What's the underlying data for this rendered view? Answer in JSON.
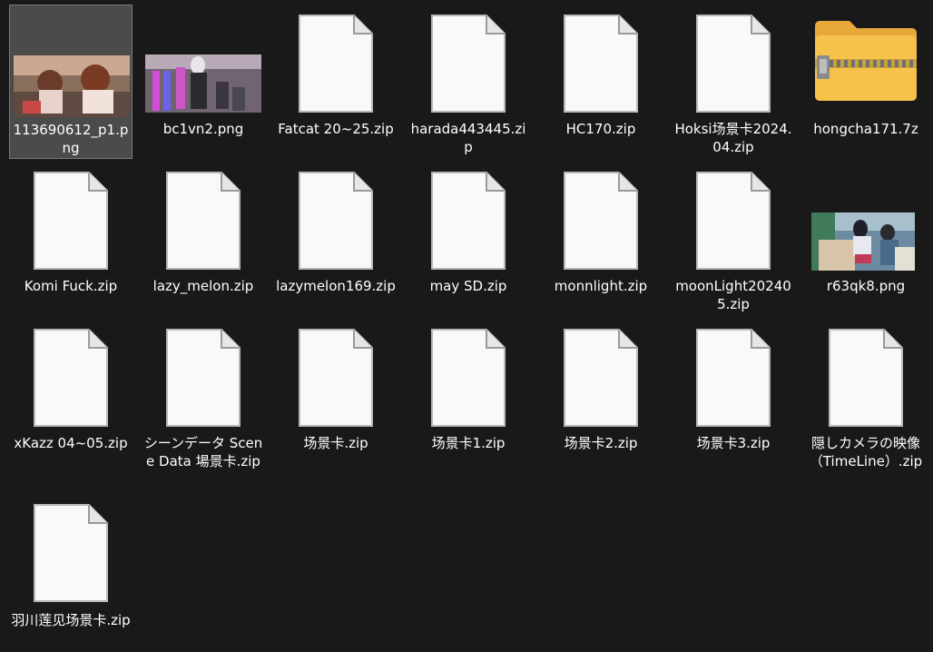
{
  "window": {
    "view": "large-icons"
  },
  "files": [
    {
      "name": "113690612_p1.png",
      "type": "image",
      "selected": true,
      "icon": "image-thumbnail-icon"
    },
    {
      "name": "bc1vn2.png",
      "type": "image",
      "selected": false,
      "icon": "image-thumbnail-icon"
    },
    {
      "name": "Fatcat 20~25.zip",
      "type": "zip",
      "selected": false,
      "icon": "generic-file-icon"
    },
    {
      "name": "harada443445.zip",
      "type": "zip",
      "selected": false,
      "icon": "generic-file-icon"
    },
    {
      "name": "HC170.zip",
      "type": "zip",
      "selected": false,
      "icon": "generic-file-icon"
    },
    {
      "name": "Hoksi场景卡2024.04.zip",
      "type": "zip",
      "selected": false,
      "icon": "generic-file-icon"
    },
    {
      "name": "hongcha171.7z",
      "type": "7z",
      "selected": false,
      "icon": "zipped-folder-icon"
    },
    {
      "name": "Komi Fuck.zip",
      "type": "zip",
      "selected": false,
      "icon": "generic-file-icon"
    },
    {
      "name": "lazy_melon.zip",
      "type": "zip",
      "selected": false,
      "icon": "generic-file-icon"
    },
    {
      "name": "lazymelon169.zip",
      "type": "zip",
      "selected": false,
      "icon": "generic-file-icon"
    },
    {
      "name": "may SD.zip",
      "type": "zip",
      "selected": false,
      "icon": "generic-file-icon"
    },
    {
      "name": "monnlight.zip",
      "type": "zip",
      "selected": false,
      "icon": "generic-file-icon"
    },
    {
      "name": "moonLight202405.zip",
      "type": "zip",
      "selected": false,
      "icon": "generic-file-icon"
    },
    {
      "name": "r63qk8.png",
      "type": "image",
      "selected": false,
      "icon": "image-thumbnail-icon"
    },
    {
      "name": "xKazz 04~05.zip",
      "type": "zip",
      "selected": false,
      "icon": "generic-file-icon"
    },
    {
      "name": "シーンデータ Scene Data 場景卡.zip",
      "type": "zip",
      "selected": false,
      "icon": "generic-file-icon"
    },
    {
      "name": "场景卡.zip",
      "type": "zip",
      "selected": false,
      "icon": "generic-file-icon"
    },
    {
      "name": "场景卡1.zip",
      "type": "zip",
      "selected": false,
      "icon": "generic-file-icon"
    },
    {
      "name": "场景卡2.zip",
      "type": "zip",
      "selected": false,
      "icon": "generic-file-icon"
    },
    {
      "name": "场景卡3.zip",
      "type": "zip",
      "selected": false,
      "icon": "generic-file-icon"
    },
    {
      "name": "隠しカメラの映像（TimeLine）.zip",
      "type": "zip",
      "selected": false,
      "icon": "generic-file-icon"
    },
    {
      "name": "羽川莲见场景卡.zip",
      "type": "zip",
      "selected": false,
      "icon": "generic-file-icon"
    }
  ],
  "colors": {
    "background": "#191919",
    "selection": "#4b4b4b",
    "label": "#ffffff",
    "file_fill": "#f9f9f9",
    "folder": "#f7c24b"
  }
}
